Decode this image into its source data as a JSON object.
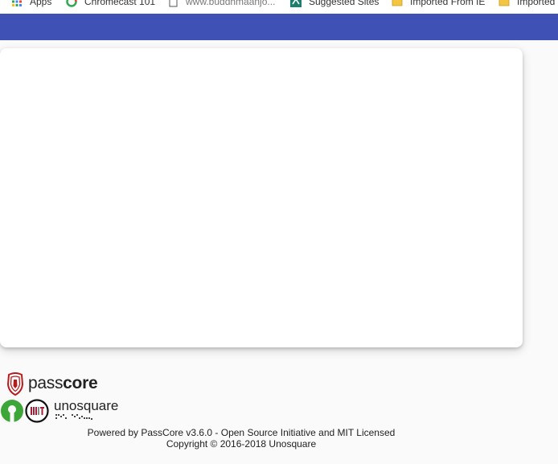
{
  "bookmarks": [
    {
      "label": "Apps",
      "icon": "apps-grid-icon"
    },
    {
      "label": "Chromecast 101",
      "icon": "google-icon"
    },
    {
      "label": "www.buddhmaanjo...",
      "icon": "page-icon"
    },
    {
      "label": "Suggested Sites",
      "icon": "suggested-sites-icon"
    },
    {
      "label": "Imported From IE",
      "icon": "folder-icon"
    },
    {
      "label": "Imported",
      "icon": "folder-icon"
    }
  ],
  "colors": {
    "appbar": "#3f51b5",
    "background": "#fafafa",
    "card": "#ffffff"
  },
  "logos": {
    "passcore_light": "pass",
    "passcore_bold": "core",
    "unosquare": "unosquare"
  },
  "footer": {
    "powered_by": "Powered by PassCore v3.6.0 - Open Source Initiative and MIT Licensed",
    "copyright": "Copyright © 2016-2018 Unosquare"
  }
}
